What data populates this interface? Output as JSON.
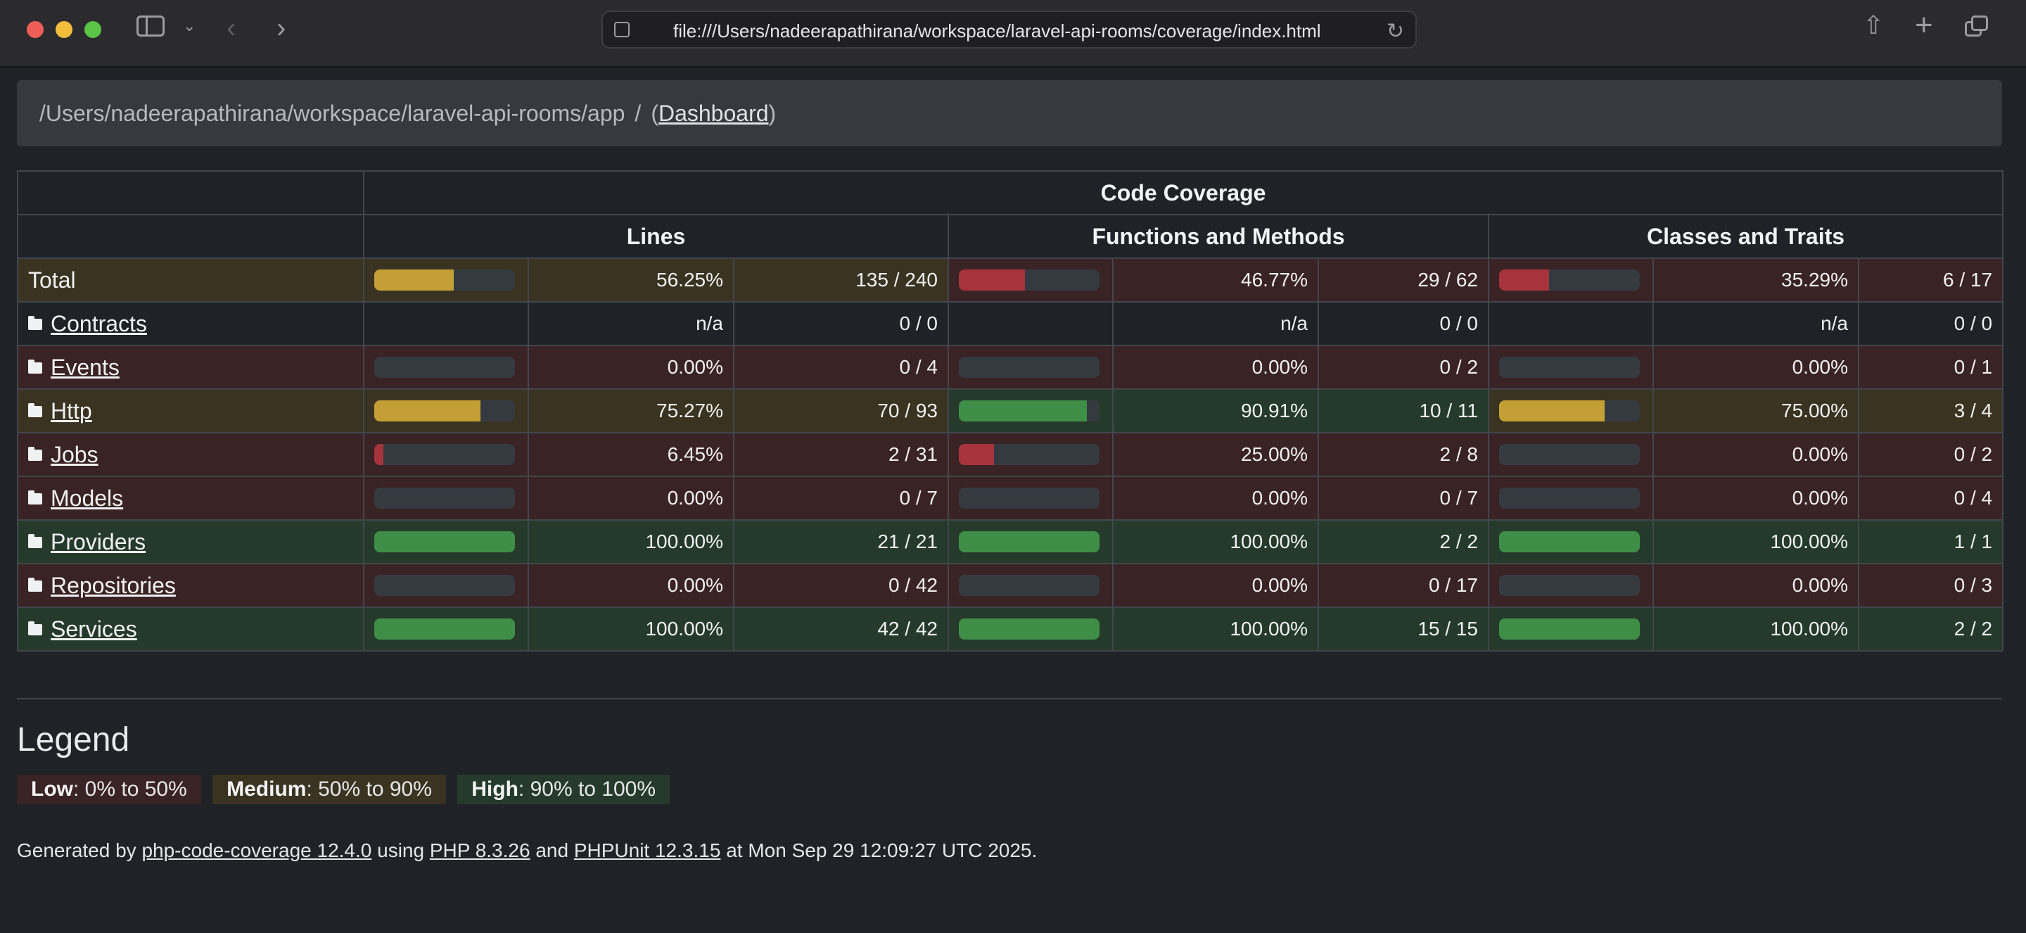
{
  "browser": {
    "url": "file:///Users/nadeerapathirana/workspace/laravel-api-rooms/coverage/index.html"
  },
  "breadcrumb": {
    "path": "/Users/nadeerapathirana/workspace/laravel-api-rooms/app",
    "separator": "/",
    "dashboard_open": "(",
    "dashboard_link": "Dashboard",
    "dashboard_close": ")"
  },
  "table": {
    "caption": "Code Coverage",
    "groups": [
      "Lines",
      "Functions and Methods",
      "Classes and Traits"
    ],
    "rows": [
      {
        "name": "Total",
        "link": false,
        "lines": {
          "pct": "56.25%",
          "count": "135 / 240",
          "level": "medium",
          "fill": 56.25
        },
        "funcs": {
          "pct": "46.77%",
          "count": "29 / 62",
          "level": "low",
          "fill": 46.77
        },
        "classes": {
          "pct": "35.29%",
          "count": "6 / 17",
          "level": "low",
          "fill": 35.29
        }
      },
      {
        "name": "Contracts",
        "link": true,
        "lines": {
          "pct": "n/a",
          "count": "0 / 0",
          "level": "na",
          "fill": null
        },
        "funcs": {
          "pct": "n/a",
          "count": "0 / 0",
          "level": "na",
          "fill": null
        },
        "classes": {
          "pct": "n/a",
          "count": "0 / 0",
          "level": "na",
          "fill": null
        }
      },
      {
        "name": "Events",
        "link": true,
        "lines": {
          "pct": "0.00%",
          "count": "0 / 4",
          "level": "low",
          "fill": 0
        },
        "funcs": {
          "pct": "0.00%",
          "count": "0 / 2",
          "level": "low",
          "fill": 0
        },
        "classes": {
          "pct": "0.00%",
          "count": "0 / 1",
          "level": "low",
          "fill": 0
        }
      },
      {
        "name": "Http",
        "link": true,
        "lines": {
          "pct": "75.27%",
          "count": "70 / 93",
          "level": "medium",
          "fill": 75.27
        },
        "funcs": {
          "pct": "90.91%",
          "count": "10 / 11",
          "level": "high",
          "fill": 90.91
        },
        "classes": {
          "pct": "75.00%",
          "count": "3 / 4",
          "level": "medium",
          "fill": 75
        }
      },
      {
        "name": "Jobs",
        "link": true,
        "lines": {
          "pct": "6.45%",
          "count": "2 / 31",
          "level": "low",
          "fill": 6.45
        },
        "funcs": {
          "pct": "25.00%",
          "count": "2 / 8",
          "level": "low",
          "fill": 25
        },
        "classes": {
          "pct": "0.00%",
          "count": "0 / 2",
          "level": "low",
          "fill": 0
        }
      },
      {
        "name": "Models",
        "link": true,
        "lines": {
          "pct": "0.00%",
          "count": "0 / 7",
          "level": "low",
          "fill": 0
        },
        "funcs": {
          "pct": "0.00%",
          "count": "0 / 7",
          "level": "low",
          "fill": 0
        },
        "classes": {
          "pct": "0.00%",
          "count": "0 / 4",
          "level": "low",
          "fill": 0
        }
      },
      {
        "name": "Providers",
        "link": true,
        "lines": {
          "pct": "100.00%",
          "count": "21 / 21",
          "level": "high",
          "fill": 100
        },
        "funcs": {
          "pct": "100.00%",
          "count": "2 / 2",
          "level": "high",
          "fill": 100
        },
        "classes": {
          "pct": "100.00%",
          "count": "1 / 1",
          "level": "high",
          "fill": 100
        }
      },
      {
        "name": "Repositories",
        "link": true,
        "lines": {
          "pct": "0.00%",
          "count": "0 / 42",
          "level": "low",
          "fill": 0
        },
        "funcs": {
          "pct": "0.00%",
          "count": "0 / 17",
          "level": "low",
          "fill": 0
        },
        "classes": {
          "pct": "0.00%",
          "count": "0 / 3",
          "level": "low",
          "fill": 0
        }
      },
      {
        "name": "Services",
        "link": true,
        "lines": {
          "pct": "100.00%",
          "count": "42 / 42",
          "level": "high",
          "fill": 100
        },
        "funcs": {
          "pct": "100.00%",
          "count": "15 / 15",
          "level": "high",
          "fill": 100
        },
        "classes": {
          "pct": "100.00%",
          "count": "2 / 2",
          "level": "high",
          "fill": 100
        }
      }
    ]
  },
  "legend": {
    "title": "Legend",
    "low_label": "Low",
    "low_range": ": 0% to 50%",
    "medium_label": "Medium",
    "medium_range": ": 50% to 90%",
    "high_label": "High",
    "high_range": ": 90% to 100%"
  },
  "footer": {
    "generated_by": "Generated by ",
    "tool_link": "php-code-coverage 12.4.0",
    "using": " using ",
    "php_link": "PHP 8.3.26",
    "and": " and ",
    "phpunit_link": "PHPUnit 12.3.15",
    "at": " at Mon Sep 29 12:09:27 UTC 2025."
  },
  "colors": {
    "low_bg": "#3a2324",
    "medium_bg": "#3a3321",
    "high_bg": "#263a2c",
    "low_bar": "#a7343c",
    "medium_bar": "#c39f35",
    "high_bar": "#3e8e47"
  }
}
